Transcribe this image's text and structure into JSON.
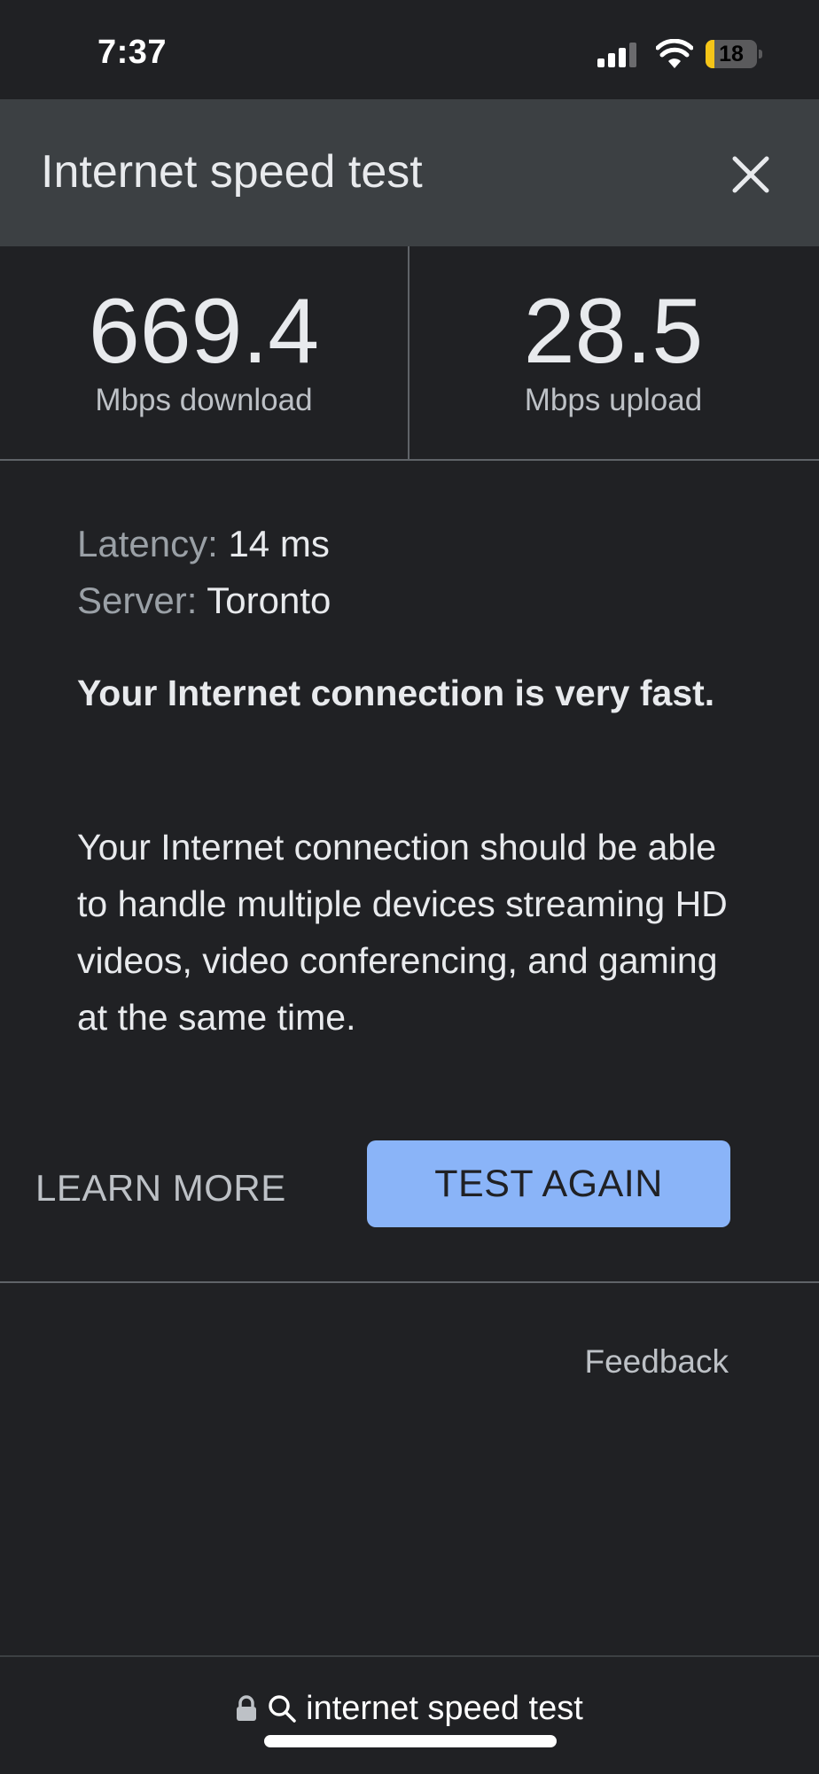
{
  "status_bar": {
    "time": "7:37",
    "battery_level": "18",
    "battery_fraction": 0.18,
    "battery_color": "#f5c518",
    "signal_icon": "cellular-signal-icon",
    "wifi_icon": "wifi-icon"
  },
  "header": {
    "title": "Internet speed test",
    "close_icon": "close-icon"
  },
  "results": {
    "download": {
      "value": "669.4",
      "label": "Mbps download"
    },
    "upload": {
      "value": "28.5",
      "label": "Mbps upload"
    }
  },
  "details": {
    "latency_key": "Latency:",
    "latency_value": "14 ms",
    "server_key": "Server:",
    "server_value": "Toronto"
  },
  "verdict": "Your Internet connection is very fast.",
  "description": "Your Internet connection should be able to handle multiple devices streaming HD videos, video conferencing, and gaming at the same time.",
  "actions": {
    "learn_more": "LEARN MORE",
    "test_again": "TEST AGAIN",
    "accent_color": "#8ab4f8"
  },
  "feedback": "Feedback",
  "address_bar": {
    "query": "internet speed test",
    "lock_icon": "lock-icon",
    "search_icon": "search-icon"
  }
}
